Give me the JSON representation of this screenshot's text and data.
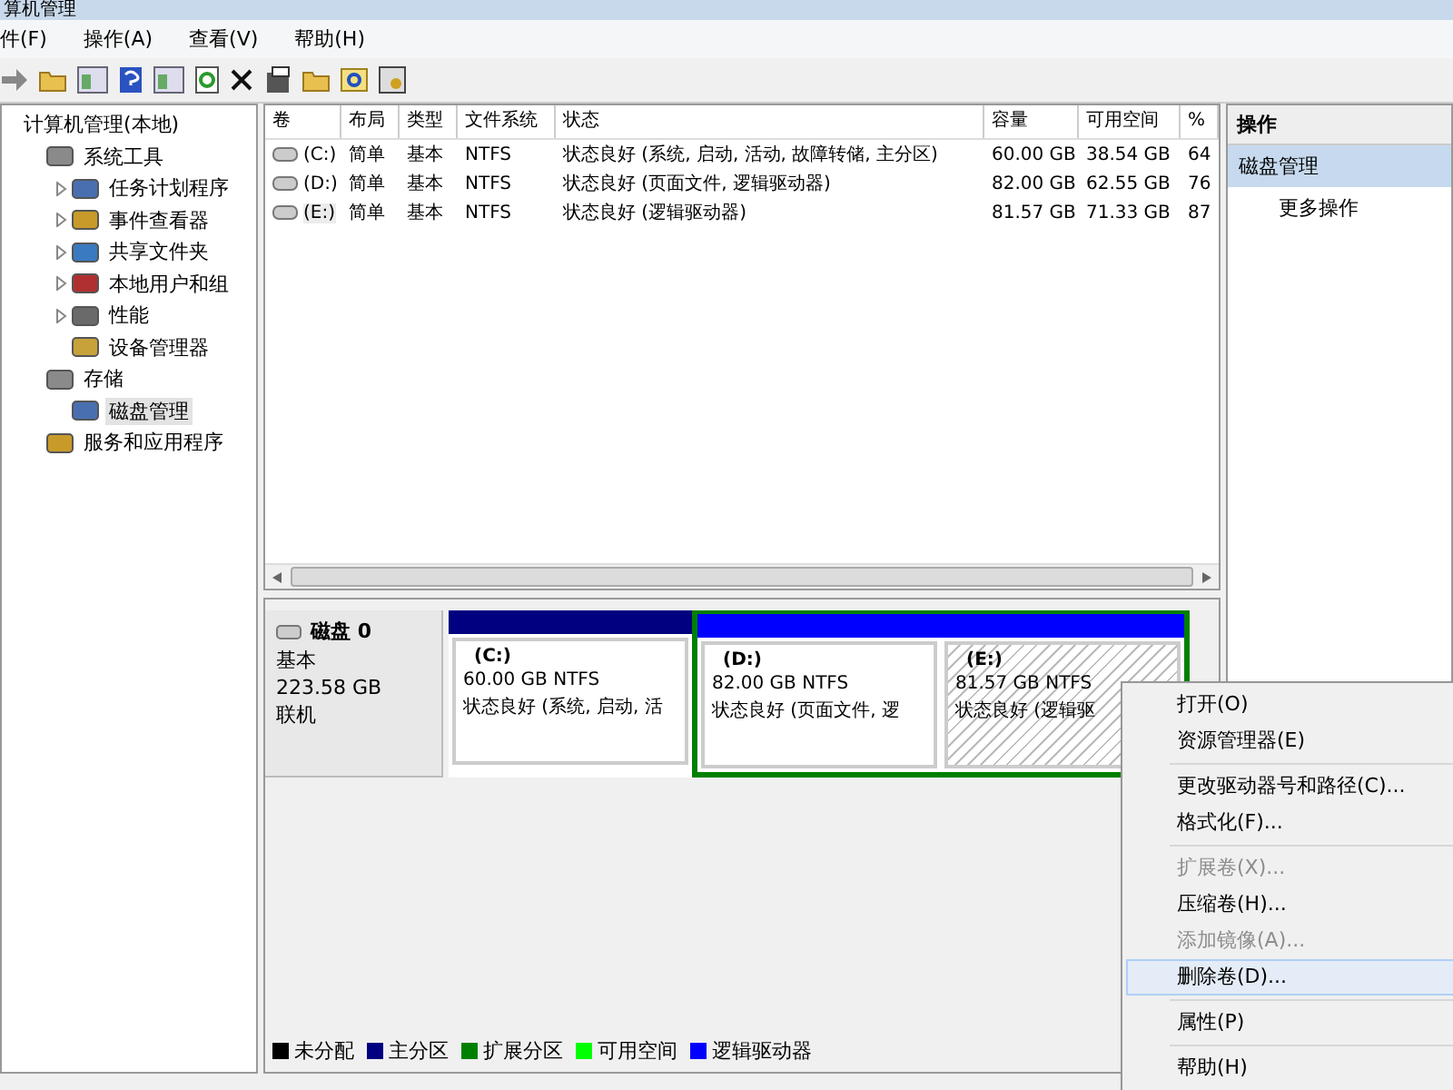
{
  "window": {
    "title": "算机管理"
  },
  "menu": [
    "件(F)",
    "操作(A)",
    "查看(V)",
    "帮助(H)"
  ],
  "toolbar": [
    {
      "kind": "forward"
    },
    {
      "kind": "folder-up"
    },
    {
      "kind": "pane"
    },
    {
      "kind": "help"
    },
    {
      "kind": "pane2"
    },
    {
      "kind": "refresh"
    },
    {
      "kind": "delete"
    },
    {
      "kind": "properties"
    },
    {
      "kind": "open"
    },
    {
      "kind": "search"
    },
    {
      "kind": "settings"
    }
  ],
  "tree": [
    {
      "label": "计算机管理(本地)",
      "selected": false,
      "children": [
        {
          "label": "系统工具",
          "kind": "leaf",
          "selected": false,
          "children": [
            {
              "label": "任务计划程序",
              "kind": "collapsed",
              "selected": false
            },
            {
              "label": "事件查看器",
              "kind": "collapsed",
              "selected": false
            },
            {
              "label": "共享文件夹",
              "kind": "collapsed",
              "selected": false
            },
            {
              "label": "本地用户和组",
              "kind": "collapsed",
              "selected": false
            },
            {
              "label": "性能",
              "kind": "collapsed",
              "selected": false
            },
            {
              "label": "设备管理器",
              "kind": "leaf",
              "selected": false
            }
          ]
        },
        {
          "label": "存储",
          "kind": "leaf",
          "selected": false,
          "children": [
            {
              "label": "磁盘管理",
              "kind": "leaf",
              "selected": true
            }
          ]
        },
        {
          "label": "服务和应用程序",
          "kind": "leaf",
          "selected": false
        }
      ]
    }
  ],
  "table": {
    "columns": [
      "卷",
      "布局",
      "类型",
      "文件系统",
      "状态",
      "容量",
      "可用空间",
      "%"
    ],
    "rows": [
      {
        "cells": [
          "(C:)",
          "简单",
          "基本",
          "NTFS",
          "状态良好 (系统, 启动, 活动, 故障转储, 主分区)",
          "60.00 GB",
          "38.54 GB",
          "64"
        ],
        "selected": false
      },
      {
        "cells": [
          "(D:)",
          "简单",
          "基本",
          "NTFS",
          "状态良好 (页面文件, 逻辑驱动器)",
          "82.00 GB",
          "62.55 GB",
          "76"
        ],
        "selected": false
      },
      {
        "cells": [
          "(E:)",
          "简单",
          "基本",
          "NTFS",
          "状态良好 (逻辑驱动器)",
          "81.57 GB",
          "71.33 GB",
          "87"
        ],
        "selected": true
      }
    ]
  },
  "disk": {
    "name": "磁盘 0",
    "type": "基本",
    "size": "223.58 GB",
    "state": "联机",
    "primary": [
      {
        "label": "(C:)",
        "size": "60.00 GB NTFS",
        "status": "状态良好 (系统, 启动, 活",
        "color": "#000080",
        "selected": false
      }
    ],
    "extended": {
      "color": "#008000",
      "partitions": [
        {
          "label": "(D:)",
          "size": "82.00 GB NTFS",
          "status": "状态良好 (页面文件, 逻",
          "color": "#0000ff",
          "selected": false
        },
        {
          "label": "(E:)",
          "size": "81.57 GB NTFS",
          "status": "状态良好 (逻辑驱",
          "color": "#0000ff",
          "selected": true
        }
      ]
    }
  },
  "legend": [
    {
      "label": "未分配",
      "color": "#000000"
    },
    {
      "label": "主分区",
      "color": "#000080"
    },
    {
      "label": "扩展分区",
      "color": "#008000"
    },
    {
      "label": "可用空间",
      "color": "#00ff00"
    },
    {
      "label": "逻辑驱动器",
      "color": "#0000ff"
    }
  ],
  "actions": {
    "title": "操作",
    "items": [
      {
        "label": "磁盘管理",
        "kind": "header"
      },
      {
        "label": "更多操作",
        "kind": "item"
      }
    ]
  },
  "context_menu": [
    {
      "label": "打开(O)",
      "disabled": false,
      "selected": false,
      "separator_after": false
    },
    {
      "label": "资源管理器(E)",
      "disabled": false,
      "selected": false,
      "separator_after": true
    },
    {
      "label": "更改驱动器号和路径(C)...",
      "disabled": false,
      "selected": false,
      "separator_after": false
    },
    {
      "label": "格式化(F)...",
      "disabled": false,
      "selected": false,
      "separator_after": true
    },
    {
      "label": "扩展卷(X)...",
      "disabled": true,
      "selected": false,
      "separator_after": false
    },
    {
      "label": "压缩卷(H)...",
      "disabled": false,
      "selected": false,
      "separator_after": false
    },
    {
      "label": "添加镜像(A)...",
      "disabled": true,
      "selected": false,
      "separator_after": false
    },
    {
      "label": "删除卷(D)...",
      "disabled": false,
      "selected": true,
      "separator_after": true
    },
    {
      "label": "属性(P)",
      "disabled": false,
      "selected": false,
      "separator_after": true
    },
    {
      "label": "帮助(H)",
      "disabled": false,
      "selected": false,
      "separator_after": false
    }
  ]
}
